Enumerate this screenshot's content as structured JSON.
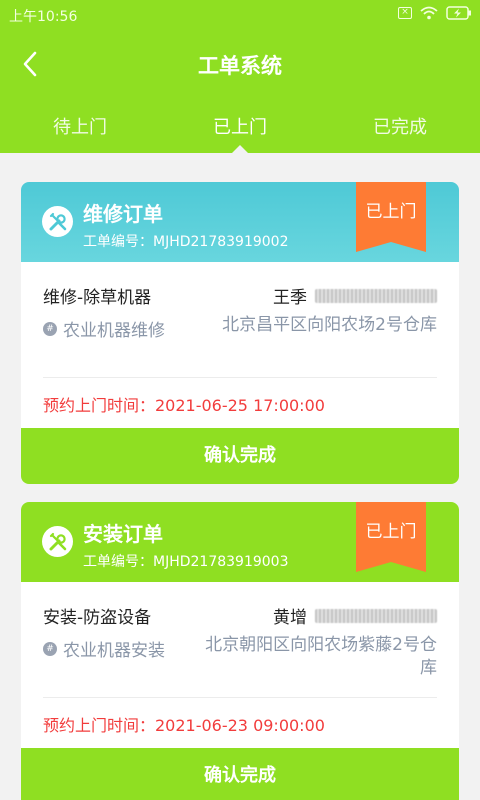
{
  "status_bar": {
    "time": "上午10:56",
    "icons": [
      "sim-off-icon",
      "wifi-icon",
      "battery-charging-icon"
    ]
  },
  "nav": {
    "title": "工单系统",
    "back_icon": "chevron-left-icon"
  },
  "tabs": [
    {
      "label": "待上门",
      "active": false
    },
    {
      "label": "已上门",
      "active": true
    },
    {
      "label": "已完成",
      "active": false
    }
  ],
  "colors": {
    "brand_green": "#8fdf22",
    "repair_header": "#4ec9d6",
    "status_ribbon": "#fe7b34",
    "appointment_red": "#f23c3c",
    "muted_text": "#8a96a8"
  },
  "orders": [
    {
      "title": "维修订单",
      "order_no": "工单编号：MJHD21783919002",
      "status": "已上门",
      "service": "维修-除草机器",
      "contact_name": "王季",
      "category": "农业机器维修",
      "address": "北京昌平区向阳农场2号仓库",
      "appointment": "预约上门时间：2021-06-25 17:00:00",
      "confirm_label": "确认完成",
      "icon": "wrench-screwdriver-icon"
    },
    {
      "title": "安装订单",
      "order_no": "工单编号：MJHD21783919003",
      "status": "已上门",
      "service": "安装-防盗设备",
      "contact_name": "黄增",
      "category": "农业机器安装",
      "address": "北京朝阳区向阳农场紫藤2号仓库",
      "appointment": "预约上门时间：2021-06-23 09:00:00",
      "confirm_label": "确认完成",
      "icon": "wrench-screwdriver-icon"
    }
  ]
}
